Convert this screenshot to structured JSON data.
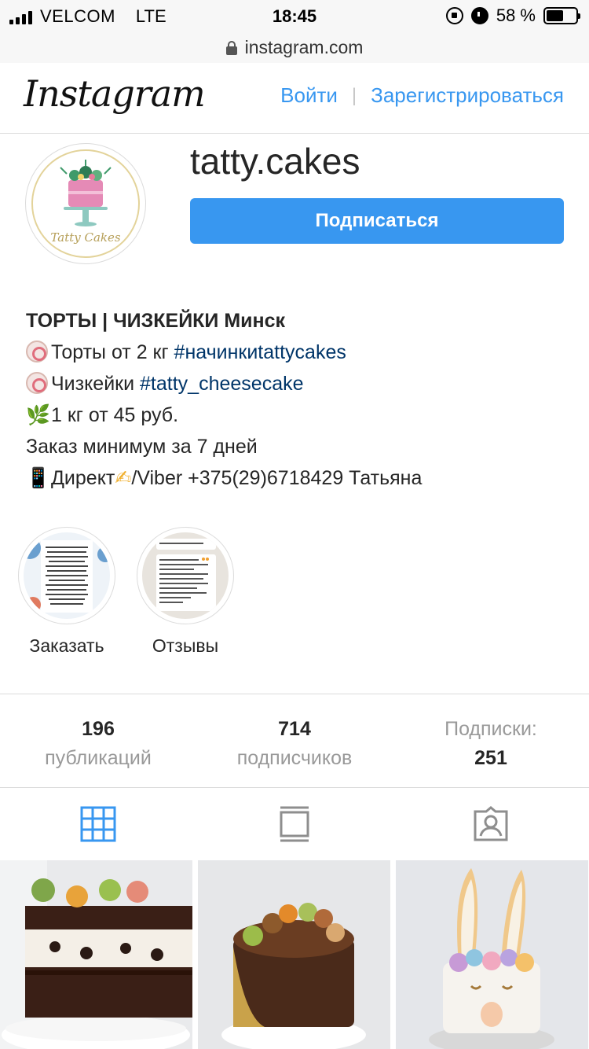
{
  "status_bar": {
    "carrier": "VELCOM",
    "network": "LTE",
    "time": "18:45",
    "battery": "58 %",
    "battery_level": 0.58
  },
  "browser": {
    "url": "instagram.com"
  },
  "header": {
    "logo": "Instagram",
    "login_label": "Войти",
    "separator": "|",
    "signup_label": "Зарегистрироваться"
  },
  "profile": {
    "username": "tatty.cakes",
    "avatar_text": "Tatty Cakes",
    "follow_label": "Подписаться"
  },
  "bio": {
    "name": "ТОРТЫ | ЧИЗКЕЙКИ Минск",
    "line1_text": "Торты от 2 кг ",
    "line1_tag": "#начинкиtattycakes",
    "line2_text": "Чизкейки ",
    "line2_tag": "#tatty_cheesecake",
    "line3_emoji": "🌿",
    "line3_text": "1 кг от 45 руб.",
    "line4_text": "Заказ минимум за 7 дней",
    "line5_emoji_phone": "📱",
    "line5_text_a": "Директ",
    "line5_emoji_write": "✍",
    "line5_text_b": "/Viber +375(29)6718429 Татьяна"
  },
  "highlights": [
    {
      "label": "Заказать"
    },
    {
      "label": "Отзывы"
    }
  ],
  "stats": {
    "posts": {
      "count": "196",
      "label": "публикаций"
    },
    "followers": {
      "count": "714",
      "label": "подписчиков"
    },
    "following": {
      "label": "Подписки:",
      "count": "251"
    }
  },
  "tabs": {
    "icons": [
      "grid-icon",
      "feed-icon",
      "tagged-icon"
    ],
    "active_color": "#3897f0",
    "inactive_color": "#8e8e8e"
  },
  "colors": {
    "accent": "#3897f0",
    "hashtag": "#003569",
    "border": "#dbdbdb"
  }
}
